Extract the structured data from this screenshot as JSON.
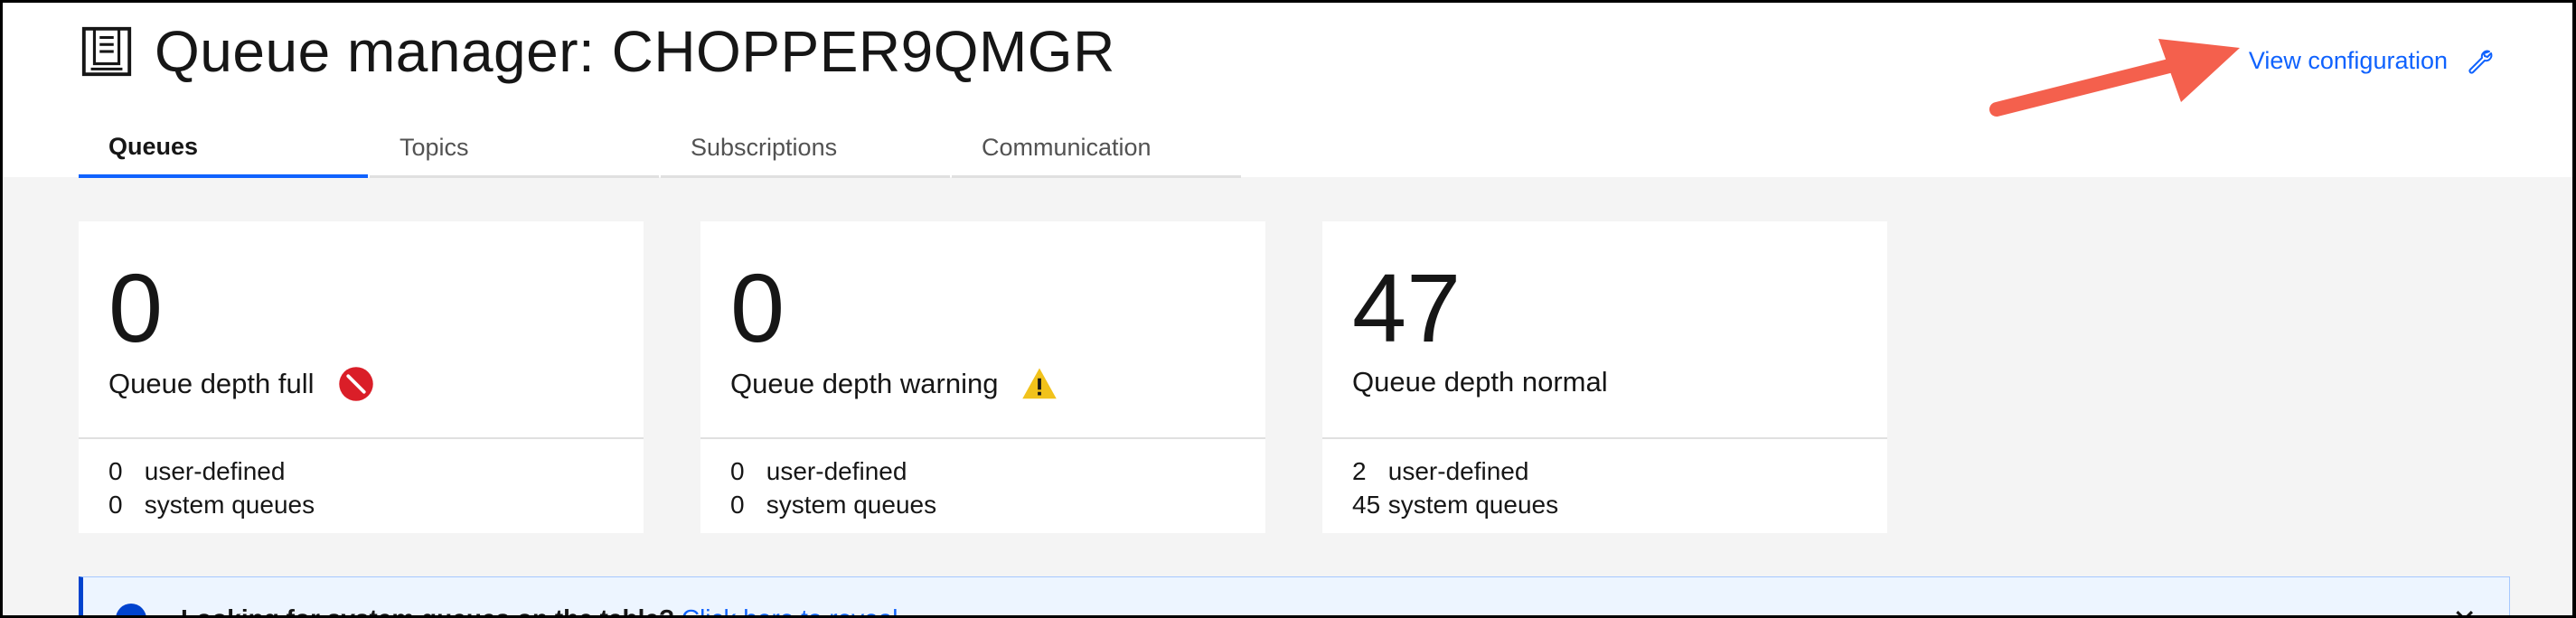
{
  "header": {
    "title": "Queue manager: CHOPPER9QMGR",
    "title_icon": "document-icon",
    "view_configuration_label": "View configuration",
    "view_configuration_icon": "wrench-icon"
  },
  "tabs": [
    {
      "label": "Queues",
      "active": true
    },
    {
      "label": "Topics",
      "active": false
    },
    {
      "label": "Subscriptions",
      "active": false
    },
    {
      "label": "Communication",
      "active": false
    }
  ],
  "tiles": [
    {
      "count": "0",
      "label": "Queue depth full",
      "status_icon": "error-icon",
      "status_color": "#da1e28",
      "user_defined_count": "0",
      "user_defined_label": "user-defined",
      "system_count": "0",
      "system_label": "system queues"
    },
    {
      "count": "0",
      "label": "Queue depth warning",
      "status_icon": "warning-icon",
      "status_color": "#f1c21b",
      "user_defined_count": "0",
      "user_defined_label": "user-defined",
      "system_count": "0",
      "system_label": "system queues"
    },
    {
      "count": "47",
      "label": "Queue depth normal",
      "status_icon": "",
      "user_defined_count": "2",
      "user_defined_label": "user-defined",
      "system_count": "45",
      "system_label": "system queues"
    }
  ],
  "notification": {
    "message": "Looking for system queues on the table?",
    "link": "Click here to reveal",
    "icon": "info-icon",
    "close_icon": "close-icon"
  },
  "annotation": {
    "arrow_color": "#f4604d"
  },
  "colors": {
    "accent": "#0f62fe",
    "background": "#f4f4f4"
  }
}
